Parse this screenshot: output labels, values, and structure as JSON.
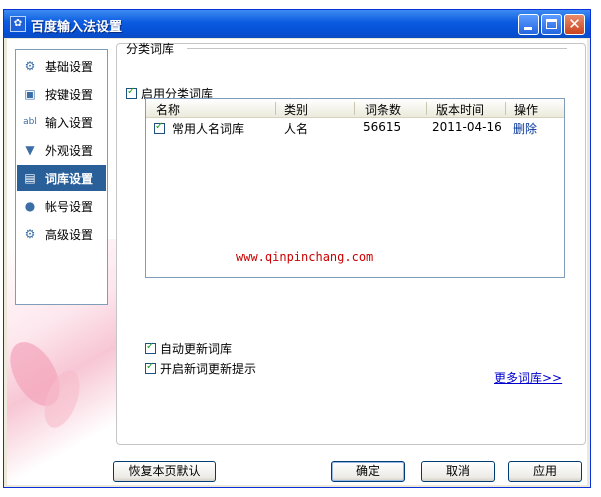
{
  "window": {
    "title": "百度输入法设置"
  },
  "sidebar": {
    "items": [
      {
        "label": "基础设置",
        "icon": "gear-icon",
        "active": false
      },
      {
        "label": "按键设置",
        "icon": "key-icon",
        "active": false
      },
      {
        "label": "输入设置",
        "icon": "abl-icon",
        "active": false
      },
      {
        "label": "外观设置",
        "icon": "shirt-icon",
        "active": false
      },
      {
        "label": "词库设置",
        "icon": "dictionary-icon",
        "active": true
      },
      {
        "label": "帐号设置",
        "icon": "user-icon",
        "active": false
      },
      {
        "label": "高级设置",
        "icon": "advanced-gear-icon",
        "active": false
      }
    ]
  },
  "main": {
    "section_title": "分类词库",
    "enable_label": "启用分类词库",
    "table": {
      "columns": [
        "名称",
        "类别",
        "词条数",
        "版本时间",
        "操作"
      ],
      "rows": [
        {
          "name": "常用人名词库",
          "category": "人名",
          "count": "56615",
          "date": "2011-04-16",
          "action": "删除",
          "checked": true
        }
      ]
    },
    "watermark": "www.qinpinchang.com",
    "auto_update_label": "自动更新词库",
    "new_word_tip_label": "开启新词更新提示",
    "more_link": "更多词库>>"
  },
  "footer": {
    "restore_label": "恢复本页默认",
    "ok_label": "确定",
    "cancel_label": "取消",
    "apply_label": "应用"
  },
  "colors": {
    "titlebar": "#0a5ae0",
    "active_nav": "#29609a",
    "link": "#003399",
    "watermark": "#cc0000"
  }
}
